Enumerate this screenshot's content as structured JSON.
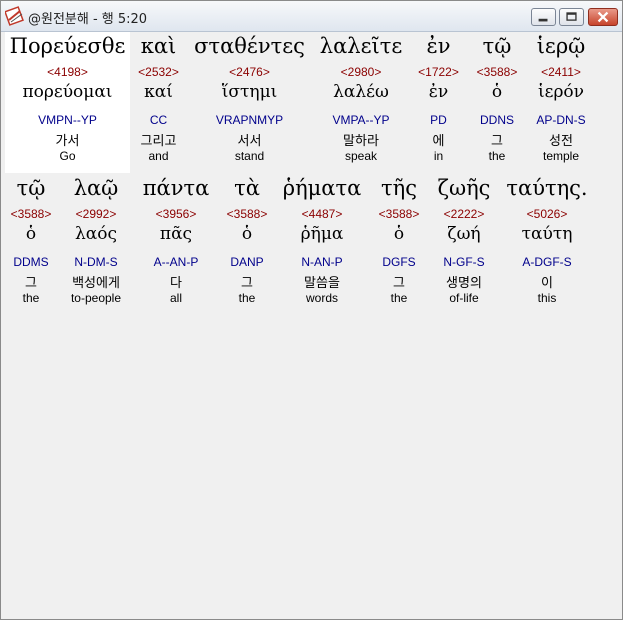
{
  "window": {
    "title": "@원전분해 - 행 5:20"
  },
  "rows": [
    [
      {
        "greek": "Πορεύεσθε",
        "strong": "<4198>",
        "lemma": "πορεύομαι",
        "parse": "VMPN--YP",
        "korean": "가서",
        "english": "Go"
      },
      {
        "greek": "καὶ",
        "strong": "<2532>",
        "lemma": "καί",
        "parse": "CC",
        "korean": "그리고",
        "english": "and"
      },
      {
        "greek": "σταθέντες",
        "strong": "<2476>",
        "lemma": "ἵστημι",
        "parse": "VRAPNMYP",
        "korean": "서서",
        "english": "stand"
      },
      {
        "greek": "λαλεῖτε",
        "strong": "<2980>",
        "lemma": "λαλέω",
        "parse": "VMPA--YP",
        "korean": "말하라",
        "english": "speak"
      },
      {
        "greek": "ἐν",
        "strong": "<1722>",
        "lemma": "ἐν",
        "parse": "PD",
        "korean": "에",
        "english": "in"
      },
      {
        "greek": "τῷ",
        "strong": "<3588>",
        "lemma": "ὁ",
        "parse": "DDNS",
        "korean": "그",
        "english": "the"
      },
      {
        "greek": "ἱερῷ",
        "strong": "<2411>",
        "lemma": "ἱερόν",
        "parse": "AP-DN-S",
        "korean": "성전",
        "english": "temple"
      }
    ],
    [
      {
        "greek": "τῷ",
        "strong": "<3588>",
        "lemma": "ὁ",
        "parse": "DDMS",
        "korean": "그",
        "english": "the"
      },
      {
        "greek": "λαῷ",
        "strong": "<2992>",
        "lemma": "λαός",
        "parse": "N-DM-S",
        "korean": "백성에게",
        "english": "to-people"
      },
      {
        "greek": "πάντα",
        "strong": "<3956>",
        "lemma": "πᾶς",
        "parse": "A--AN-P",
        "korean": "다",
        "english": "all"
      },
      {
        "greek": "τὰ",
        "strong": "<3588>",
        "lemma": "ὁ",
        "parse": "DANP",
        "korean": "그",
        "english": "the"
      },
      {
        "greek": "ῥήματα",
        "strong": "<4487>",
        "lemma": "ῥῆμα",
        "parse": "N-AN-P",
        "korean": "말씀을",
        "english": "words"
      },
      {
        "greek": "τῆς",
        "strong": "<3588>",
        "lemma": "ὁ",
        "parse": "DGFS",
        "korean": "그",
        "english": "the"
      },
      {
        "greek": "ζωῆς",
        "strong": "<2222>",
        "lemma": "ζωή",
        "parse": "N-GF-S",
        "korean": "생명의",
        "english": "of-life"
      },
      {
        "greek": "ταύτης.",
        "strong": "<5026>",
        "lemma": "ταύτη",
        "parse": "A-DGF-S",
        "korean": "이",
        "english": "this"
      }
    ]
  ]
}
